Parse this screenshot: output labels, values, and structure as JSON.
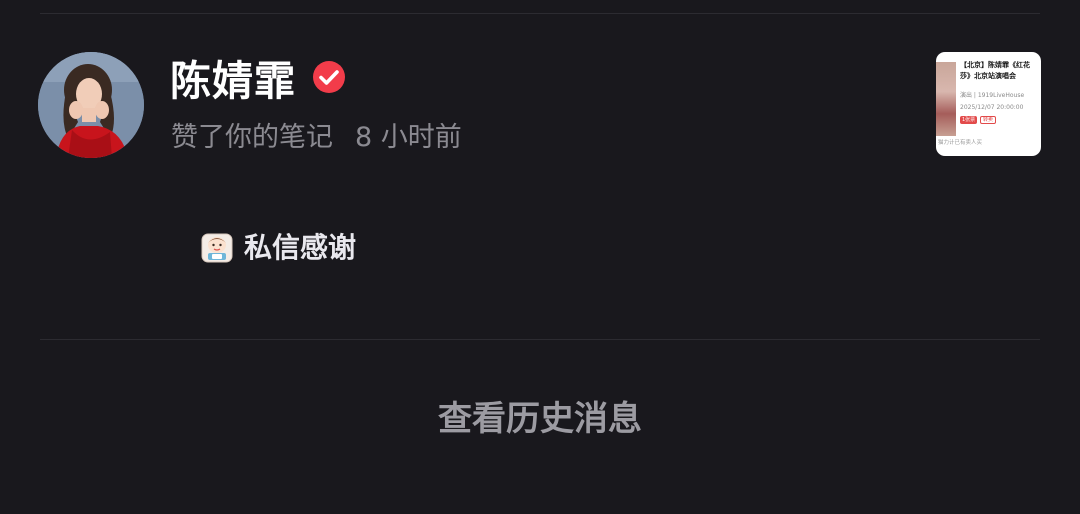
{
  "notification": {
    "username": "陈婧霏",
    "verified_icon": "verified-check-icon",
    "action_text": "赞了你的笔记",
    "time_ago": "8 小时前",
    "note_thumbnail": {
      "title": "【北京】陈婧霏《红花莎》北京站演唱会",
      "venue": "演出 | 1919LiveHouse",
      "datetime": "2025/12/07 20:00:00",
      "tag_primary": "1张票",
      "tag_secondary": "转卖",
      "footer": "猫力计已有卖人买"
    },
    "dm_button": {
      "icon": "sticker-emoji-icon",
      "label": "私信感谢"
    }
  },
  "footer": {
    "history_label": "查看历史消息"
  },
  "colors": {
    "background": "#19181d",
    "divider": "#2c2b31",
    "verified_badge": "#f23c4a",
    "primary_text": "#ffffff",
    "secondary_text": "#8b8a91"
  }
}
